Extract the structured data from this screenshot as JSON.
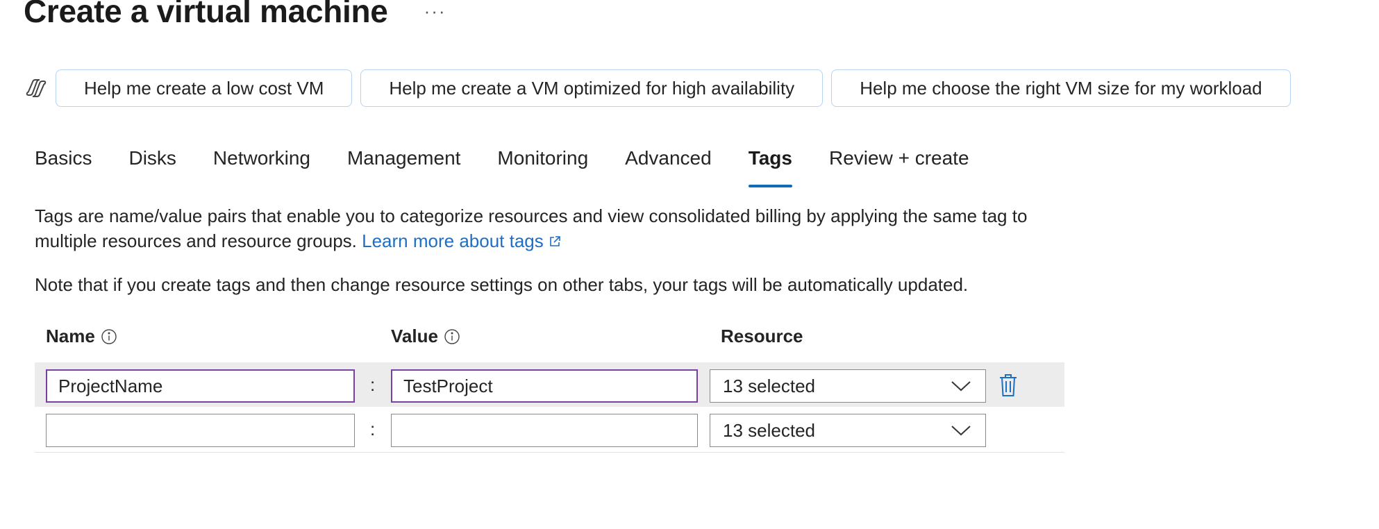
{
  "header": {
    "title": "Create a virtual machine",
    "more_label": "···"
  },
  "copilot": {
    "icon": "copilot-icon",
    "suggestions": [
      "Help me create a low cost VM",
      "Help me create a VM optimized for high availability",
      "Help me choose the right VM size for my workload"
    ]
  },
  "tabs": [
    {
      "label": "Basics",
      "active": false
    },
    {
      "label": "Disks",
      "active": false
    },
    {
      "label": "Networking",
      "active": false
    },
    {
      "label": "Management",
      "active": false
    },
    {
      "label": "Monitoring",
      "active": false
    },
    {
      "label": "Advanced",
      "active": false
    },
    {
      "label": "Tags",
      "active": true
    },
    {
      "label": "Review + create",
      "active": false
    }
  ],
  "description": {
    "text": "Tags are name/value pairs that enable you to categorize resources and view consolidated billing by applying the same tag to multiple resources and resource groups.",
    "link_label": "Learn more about tags",
    "link_icon": "external-link-icon"
  },
  "note": "Note that if you create tags and then change resource settings on other tabs, your tags will be automatically updated.",
  "table": {
    "columns": {
      "name": "Name",
      "value": "Value",
      "resource": "Resource"
    },
    "separator": ":",
    "rows": [
      {
        "name": "ProjectName",
        "value": "TestProject",
        "resource": "13 selected"
      },
      {
        "name": "",
        "value": "",
        "resource": "13 selected"
      }
    ]
  },
  "colors": {
    "accent": "#0f6cbd",
    "link": "#1c6fc5",
    "focus_border": "#7b3fa0",
    "row_highlight": "#ececec",
    "chip_border": "#b7d3f2"
  }
}
